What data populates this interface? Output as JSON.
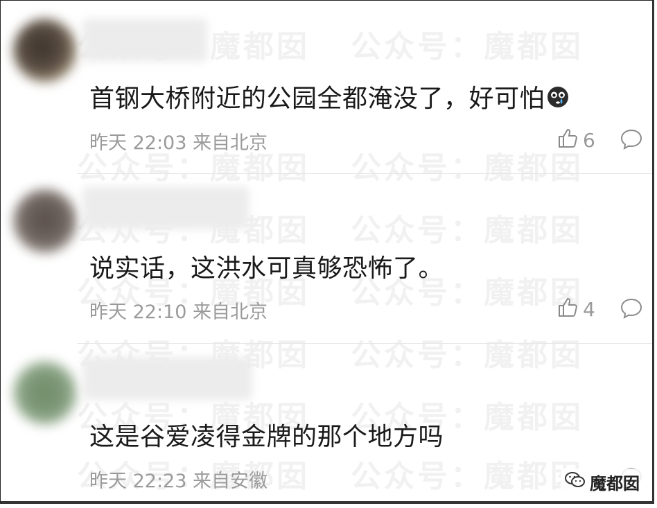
{
  "watermark_text": "公众号：魔都囡",
  "comments": [
    {
      "text": "首钢大桥附近的公园全都淹没了，好可怕",
      "emoji": "crying-face",
      "time": "昨天 22:03",
      "location": "来自北京",
      "likes": "6",
      "avatar_color": "#5a4e44"
    },
    {
      "text": "说实话，这洪水可真够恐怖了。",
      "time": "昨天 22:10",
      "location": "来自北京",
      "likes": "4",
      "avatar_color": "#6e6460"
    },
    {
      "text": "这是谷爱凌得金牌的那个地方吗",
      "time": "昨天 22:23",
      "location": "来自安徽",
      "avatar_color": "#7f9a7a"
    }
  ],
  "brand": {
    "name": "魔都囡"
  }
}
